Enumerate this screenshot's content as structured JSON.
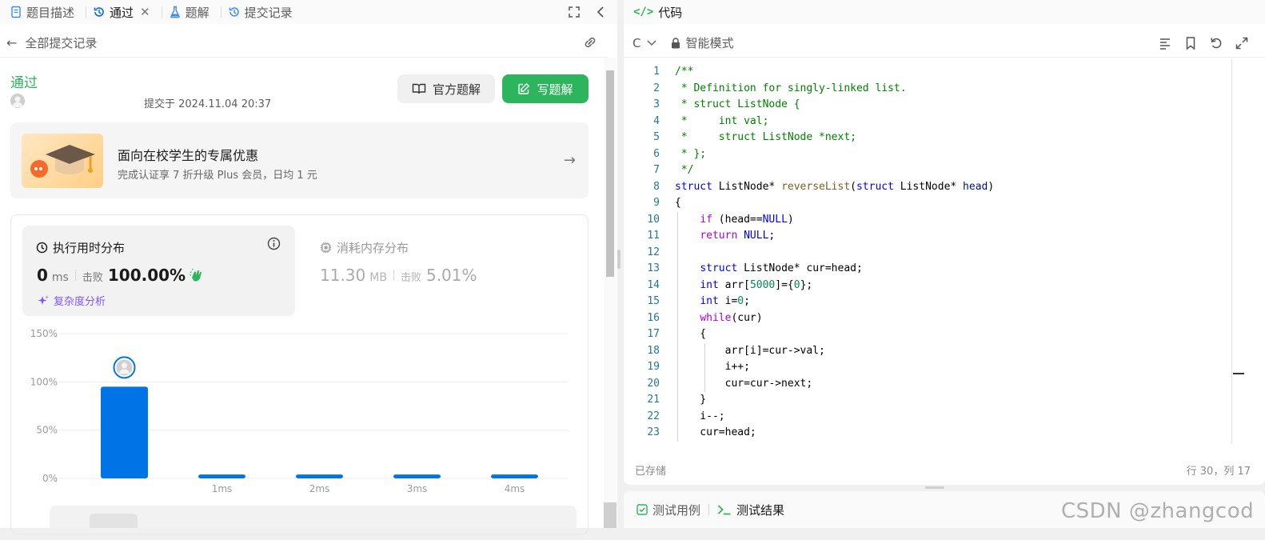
{
  "left_tabs": [
    {
      "label": "题目描述",
      "icon": "document-icon"
    },
    {
      "label": "通过",
      "icon": "history-icon",
      "active": true
    },
    {
      "label": "题解",
      "icon": "flask-icon"
    },
    {
      "label": "提交记录",
      "icon": "history-icon"
    }
  ],
  "subbar": {
    "title": "全部提交记录"
  },
  "submission": {
    "status": "通过",
    "submitted_at": "提交于 2024.11.04 20:37",
    "official_label": "官方题解",
    "write_label": "写题解"
  },
  "promo": {
    "title": "面向在校学生的专属优惠",
    "subtitle": "完成认证享 7 折升级 Plus 会员，日均 1 元"
  },
  "runtime": {
    "title": "执行用时分布",
    "value": "0",
    "unit": "ms",
    "beat_label": "击败",
    "beat_value": "100.00%",
    "complexity_label": "复杂度分析"
  },
  "memory": {
    "title": "消耗内存分布",
    "value": "11.30",
    "unit": "MB",
    "beat_label": "击败",
    "beat_value": "5.01%"
  },
  "chart_data": {
    "type": "bar",
    "categories": [
      "0ms",
      "1ms",
      "2ms",
      "3ms",
      "4ms"
    ],
    "x_tick_labels": [
      "",
      "1ms",
      "2ms",
      "3ms",
      "4ms"
    ],
    "values": [
      95,
      4,
      4,
      4,
      4
    ],
    "ylim": [
      0,
      150
    ],
    "y_ticks": [
      "0%",
      "50%",
      "100%",
      "150%"
    ],
    "grid": true,
    "bar_color": "#0073e6",
    "highlight_category": "0ms"
  },
  "code_panel": {
    "title": "代码",
    "language": "C",
    "mode": "智能模式",
    "saved": "已存储",
    "cursor": "行 30，列 17"
  },
  "code_lines": [
    {
      "n": "1",
      "html": "<span class=\"cm\">/**</span>"
    },
    {
      "n": "2",
      "html": "<span class=\"cm\"> * Definition for singly-linked list.</span>"
    },
    {
      "n": "3",
      "html": "<span class=\"cm\"> * struct ListNode {</span>"
    },
    {
      "n": "4",
      "html": "<span class=\"cm\"> *     int val;</span>"
    },
    {
      "n": "5",
      "html": "<span class=\"cm\"> *     struct ListNode *next;</span>"
    },
    {
      "n": "6",
      "html": "<span class=\"cm\"> * };</span>"
    },
    {
      "n": "7",
      "html": "<span class=\"cm\"> */</span>"
    },
    {
      "n": "8",
      "html": "<span class=\"kw\">struct</span> ListNode* <span class=\"fn\">reverseList</span>(<span class=\"kw\">struct</span> ListNode* <span class=\"param\">head</span>)"
    },
    {
      "n": "9",
      "html": "{"
    },
    {
      "n": "10",
      "html": "    <span class=\"kw2\">if</span> (head==<span class=\"kw\">NULL</span>)"
    },
    {
      "n": "11",
      "html": "    <span class=\"kw2\">return</span> <span class=\"kw\">NULL</span>;"
    },
    {
      "n": "12",
      "html": ""
    },
    {
      "n": "13",
      "html": "    <span class=\"kw\">struct</span> ListNode* cur=head;"
    },
    {
      "n": "14",
      "html": "    <span class=\"kw\">int</span> arr[<span class=\"num\">5000</span>]={<span class=\"num\">0</span>};"
    },
    {
      "n": "15",
      "html": "    <span class=\"kw\">int</span> i=<span class=\"num\">0</span>;"
    },
    {
      "n": "16",
      "html": "    <span class=\"kw2\">while</span>(cur)"
    },
    {
      "n": "17",
      "html": "    {"
    },
    {
      "n": "18",
      "html": "        arr[i]=cur->val;"
    },
    {
      "n": "19",
      "html": "        i++;"
    },
    {
      "n": "20",
      "html": "        cur=cur->next;"
    },
    {
      "n": "21",
      "html": "    }"
    },
    {
      "n": "22",
      "html": "    i--;"
    },
    {
      "n": "23",
      "html": "    cur=head;"
    }
  ],
  "test_tabs": [
    {
      "label": "测试用例",
      "icon": "checkbox-icon"
    },
    {
      "label": "测试结果",
      "icon": "terminal-icon",
      "active": true
    }
  ],
  "watermark": "CSDN @zhangcod",
  "colors": {
    "accent_green": "#2db55d",
    "bar_blue": "#0073e6",
    "purple": "#7f55ff"
  }
}
